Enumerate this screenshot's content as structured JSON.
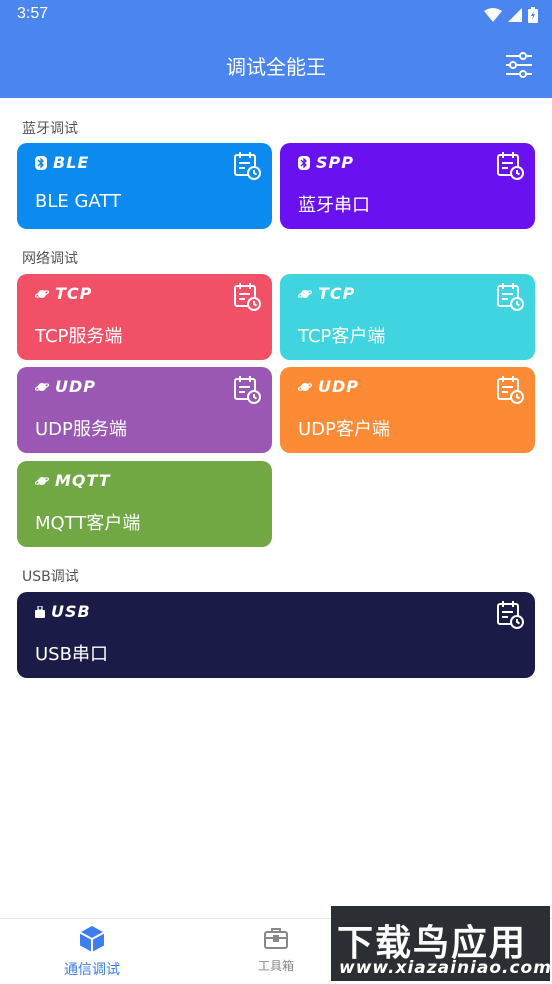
{
  "status": {
    "time": "3:57"
  },
  "header": {
    "title": "调试全能王"
  },
  "sections": {
    "bluetooth": "蓝牙调试",
    "network": "网络调试",
    "usb": "USB调试"
  },
  "cards": {
    "ble": {
      "badge": "BLE",
      "label": "BLE GATT",
      "color": "#0b8af0"
    },
    "spp": {
      "badge": "SPP",
      "label": "蓝牙串口",
      "color": "#6a11f2"
    },
    "tcp_server": {
      "badge": "TCP",
      "label": "TCP服务端",
      "color": "#f25067"
    },
    "tcp_client": {
      "badge": "TCP",
      "label": "TCP客户端",
      "color": "#3fd4e0"
    },
    "udp_server": {
      "badge": "UDP",
      "label": "UDP服务端",
      "color": "#9a58b4"
    },
    "udp_client": {
      "badge": "UDP",
      "label": "UDP客户端",
      "color": "#fd8b35"
    },
    "mqtt_client": {
      "badge": "MQTT",
      "label": "MQTT客户端",
      "color": "#71a843"
    },
    "usb_serial": {
      "badge": "USB",
      "label": "USB串口",
      "color": "#1b1b47"
    }
  },
  "nav": {
    "comm_debug": "通信调试",
    "toolbox": "工具箱"
  },
  "watermark": {
    "title": "下载鸟应用",
    "url": "www.xiazainiao.com"
  },
  "colors": {
    "primary": "#4a85f0",
    "nav_active": "#3d7ff0",
    "nav_inactive": "#888888"
  }
}
